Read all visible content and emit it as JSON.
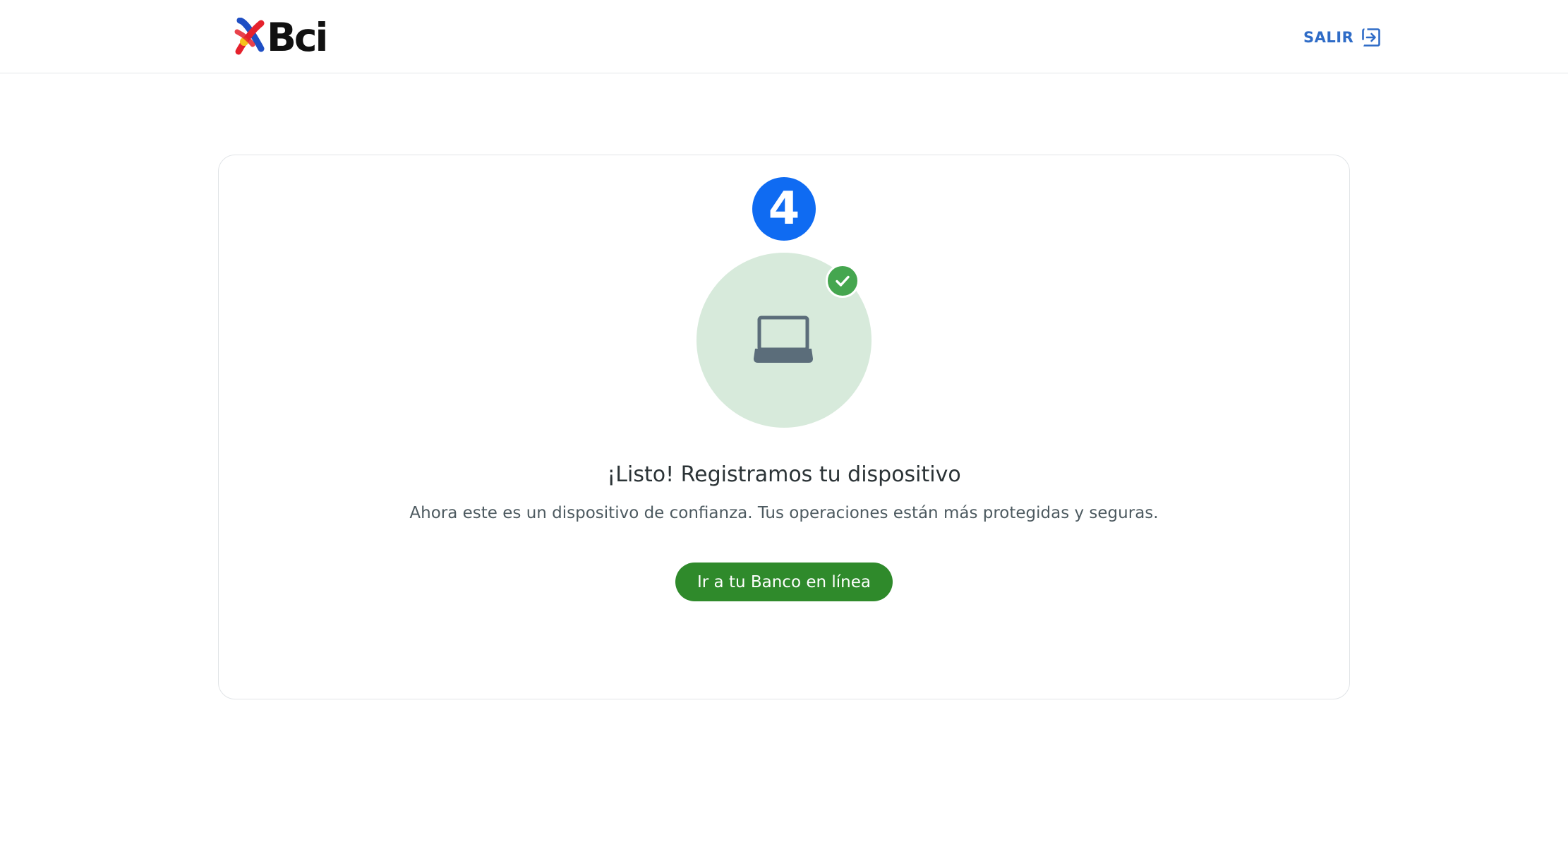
{
  "header": {
    "logo_text": "Bci",
    "logout_label": "SALIR",
    "logout_icon": "logout-icon"
  },
  "step": {
    "number": "4"
  },
  "illustration": {
    "device_icon": "laptop-icon",
    "status_icon": "check-icon",
    "colors": {
      "circle_bg": "#d7eadb",
      "check_bg": "#45a64f",
      "laptop": "#5b6d7a"
    }
  },
  "content": {
    "title": "¡Listo! Registramos tu dispositivo",
    "subtitle": "Ahora este es un dispositivo de confianza. Tus operaciones están más protegidas y seguras.",
    "cta_label": "Ir a tu Banco en línea"
  },
  "colors": {
    "step_badge": "#0f6bf2",
    "cta": "#2f8a2b",
    "link": "#2f6cc7"
  }
}
